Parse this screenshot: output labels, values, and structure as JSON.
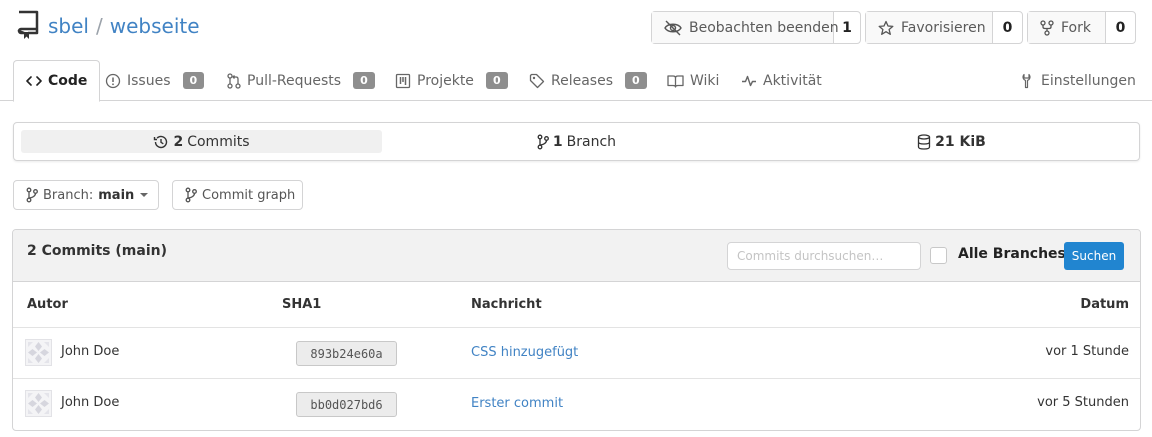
{
  "repo": {
    "owner": "sbel",
    "separator": "/",
    "name": "webseite"
  },
  "header_actions": {
    "watch": {
      "label": "Beobachten beenden",
      "count": "1"
    },
    "star": {
      "label": "Favorisieren",
      "count": "0"
    },
    "fork": {
      "label": "Fork",
      "count": "0"
    }
  },
  "tabs": [
    {
      "label": "Code"
    },
    {
      "label": "Issues",
      "badge": "0"
    },
    {
      "label": "Pull-Requests",
      "badge": "0"
    },
    {
      "label": "Projekte",
      "badge": "0"
    },
    {
      "label": "Releases",
      "badge": "0"
    },
    {
      "label": "Wiki"
    },
    {
      "label": "Aktivität"
    },
    {
      "label": "Einstellungen"
    }
  ],
  "stats": {
    "commits": {
      "count": "2",
      "label": "Commits"
    },
    "branches": {
      "count": "1",
      "label": "Branch"
    },
    "size": {
      "value": "21 KiB"
    }
  },
  "toolbar": {
    "branch_prefix": "Branch:",
    "branch_name": "main",
    "graph_label": "Commit graph"
  },
  "commits": {
    "title": "2 Commits (main)",
    "search_placeholder": "Commits durchsuchen…",
    "all_branches_label": "Alle Branches",
    "search_button": "Suchen",
    "columns": {
      "author": "Autor",
      "sha": "SHA1",
      "message": "Nachricht",
      "date": "Datum"
    },
    "rows": [
      {
        "author": "John Doe",
        "sha": "893b24e60a",
        "message": "CSS hinzugefügt",
        "date": "vor 1 Stunde"
      },
      {
        "author": "John Doe",
        "sha": "bb0d027bd6",
        "message": "Erster commit",
        "date": "vor 5 Stunden"
      }
    ]
  },
  "colors": {
    "link": "#4183c4",
    "primary_button": "#2185d0",
    "badge": "#8e8e8e"
  }
}
